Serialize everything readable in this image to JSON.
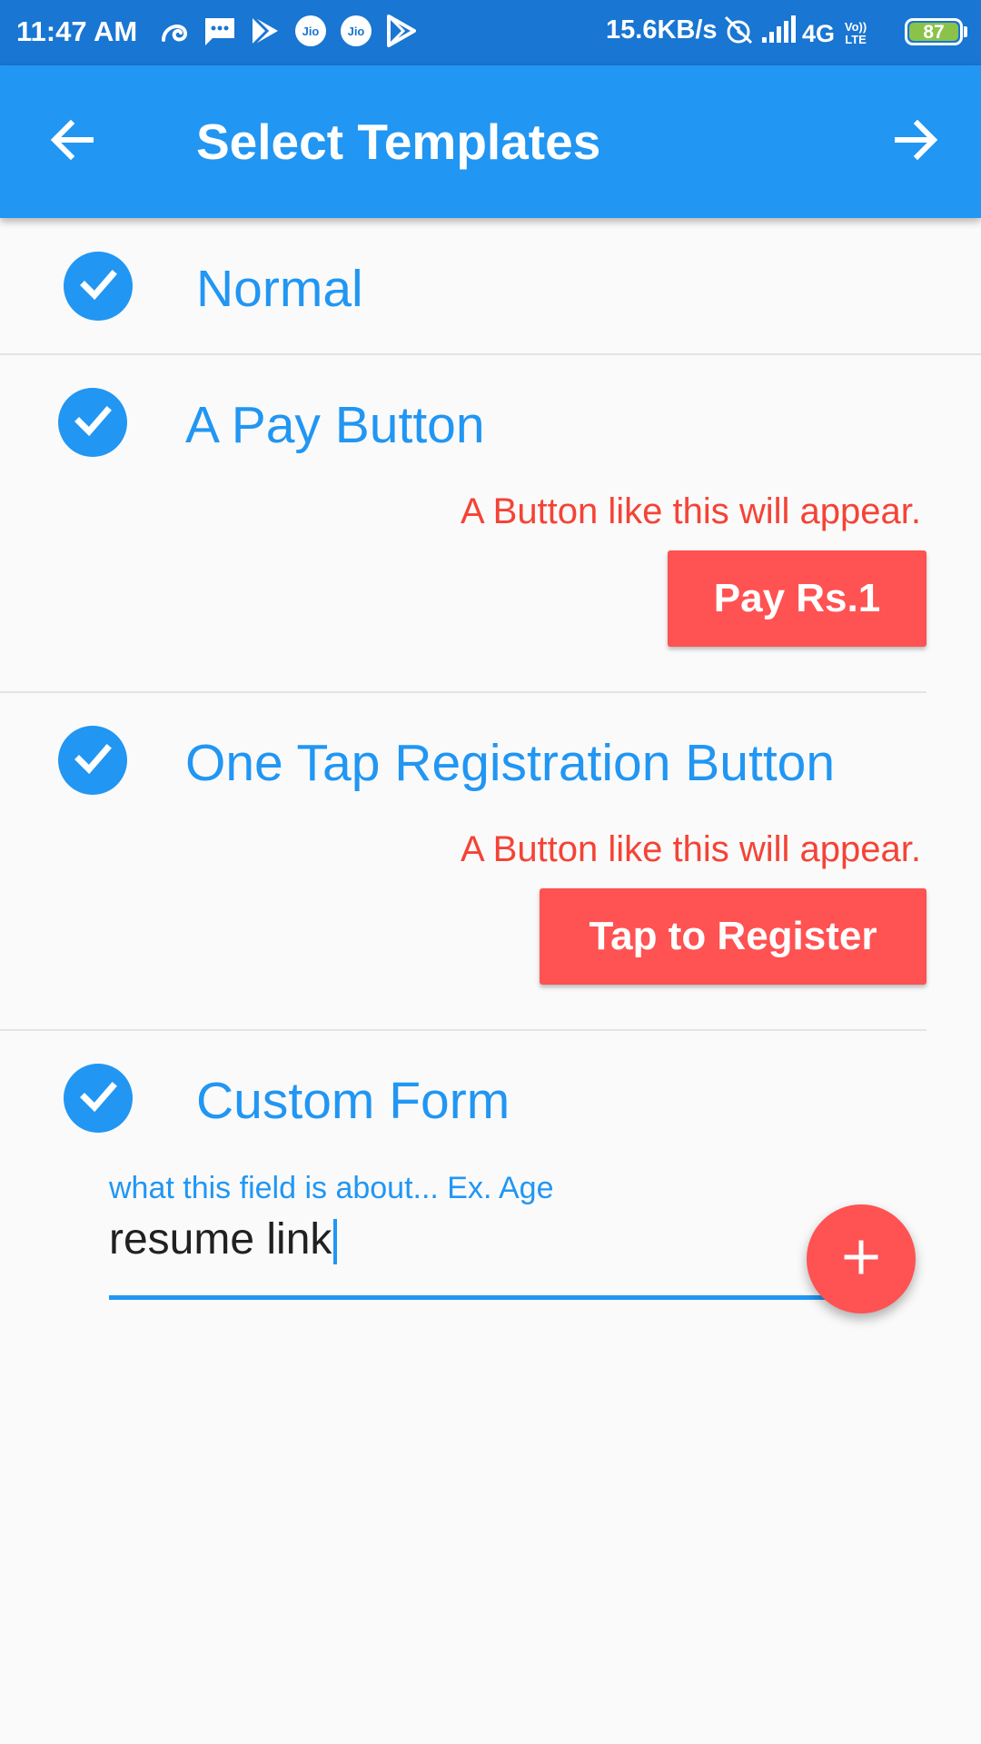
{
  "status_bar": {
    "time": "11:47 AM",
    "speed": "15.6KB/s",
    "network": "4G",
    "volte": "Vo)) LTE",
    "battery": "87",
    "left_icons": [
      "uc-browser-icon",
      "message-icon",
      "play-icon",
      "jio-icon",
      "jio-icon",
      "play-store-icon"
    ],
    "right_icons": [
      "alarm-off-icon",
      "signal-icon"
    ]
  },
  "app_bar": {
    "title": "Select Templates",
    "back_icon": "arrow-back-icon",
    "next_icon": "arrow-forward-icon"
  },
  "templates": [
    {
      "title": "Normal",
      "checked": true
    },
    {
      "title": "A Pay Button",
      "checked": true,
      "hint": "A Button like this will appear.",
      "button_label": "Pay Rs.1"
    },
    {
      "title": "One Tap Registration Button",
      "checked": true,
      "hint": "A Button like this will appear.",
      "button_label": "Tap to Register"
    },
    {
      "title": "Custom Form",
      "checked": true,
      "field": {
        "label": "what this field is about... Ex. Age",
        "value": "resume link"
      },
      "add_icon": "plus-icon"
    }
  ],
  "colors": {
    "status_bar": "#1976d2",
    "primary": "#2196f3",
    "accent_red": "#ff5252",
    "hint_red": "#f44336",
    "background": "#fafafa"
  }
}
